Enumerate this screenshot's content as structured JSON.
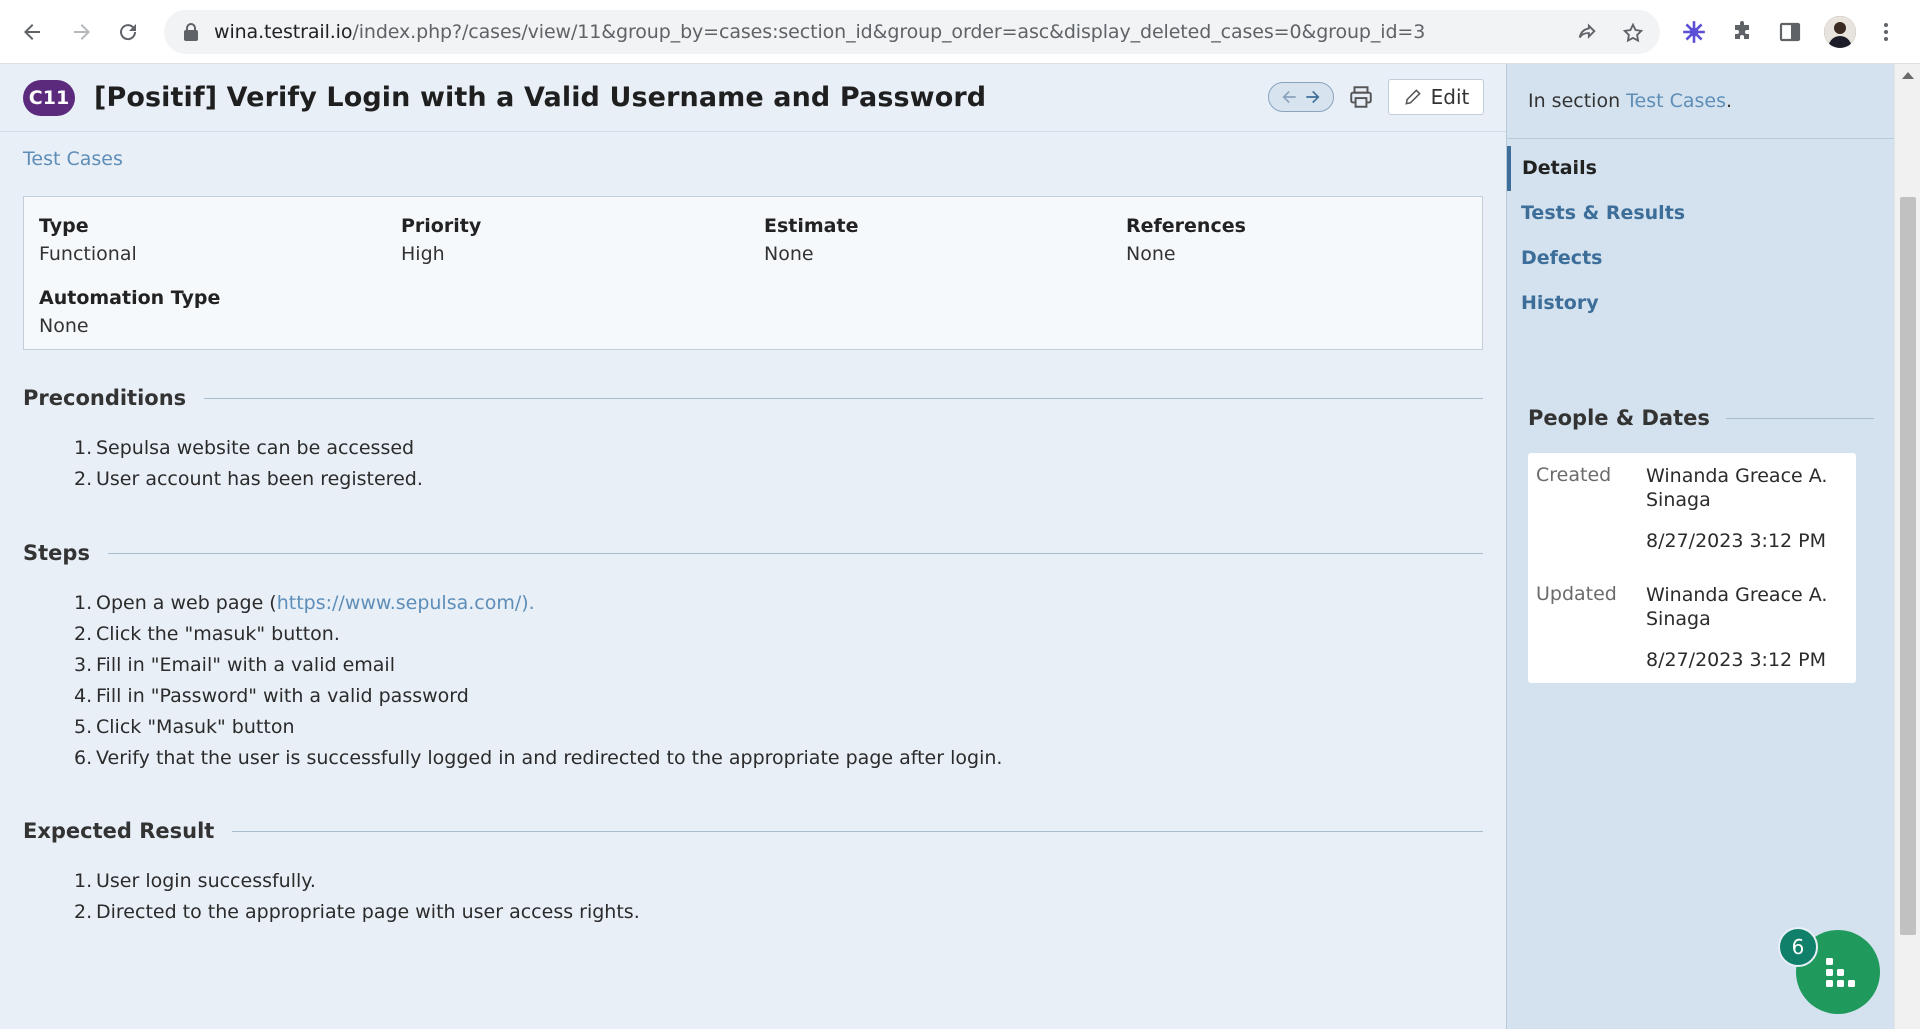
{
  "browser": {
    "url_host": "wina.testrail.io",
    "url_path": "/index.php?/cases/view/11&group_by=cases:section_id&group_order=asc&display_deleted_cases=0&group_id=3"
  },
  "case": {
    "badge": "C11",
    "title": "[Positif] Verify Login with a Valid Username and Password",
    "edit_label": "Edit",
    "breadcrumb": "Test Cases"
  },
  "fields": {
    "type": {
      "label": "Type",
      "value": "Functional"
    },
    "priority": {
      "label": "Priority",
      "value": "High"
    },
    "estimate": {
      "label": "Estimate",
      "value": "None"
    },
    "references": {
      "label": "References",
      "value": "None"
    },
    "automation_type": {
      "label": "Automation Type",
      "value": "None"
    }
  },
  "preconditions": {
    "heading": "Preconditions",
    "items": [
      {
        "num": "1.",
        "text": "Sepulsa website can be accessed"
      },
      {
        "num": "2.",
        "text": "User account has been registered."
      }
    ]
  },
  "steps": {
    "heading": "Steps",
    "items": [
      {
        "num": "1.",
        "text": "Open a web page (",
        "link": "https://www.sepulsa.com/).",
        "after": ""
      },
      {
        "num": "2.",
        "text": "Click the \"masuk\" button."
      },
      {
        "num": "3.",
        "text": "Fill in \"Email\" with a valid email"
      },
      {
        "num": "4.",
        "text": "Fill in \"Password\" with a valid password"
      },
      {
        "num": "5.",
        "text": "Click \"Masuk\" button"
      },
      {
        "num": "6.",
        "text": "Verify that the user is successfully logged in and redirected to the appropriate page after login."
      }
    ]
  },
  "expected": {
    "heading": "Expected Result",
    "items": [
      {
        "num": "1.",
        "text": "User login successfully."
      },
      {
        "num": "2.",
        "text": "Directed to the appropriate page with user access rights."
      }
    ]
  },
  "sidebar": {
    "in_section_prefix": "In section ",
    "in_section_link": "Test Cases",
    "in_section_suffix": ".",
    "nav": [
      {
        "label": "Details",
        "active": true
      },
      {
        "label": "Tests & Results",
        "active": false
      },
      {
        "label": "Defects",
        "active": false
      },
      {
        "label": "History",
        "active": false
      }
    ],
    "people_dates_heading": "People & Dates",
    "created": {
      "label": "Created",
      "who": "Winanda Greace A. Sinaga",
      "when": "8/27/2023 3:12 PM"
    },
    "updated": {
      "label": "Updated",
      "who": "Winanda Greace A. Sinaga",
      "when": "8/27/2023 3:12 PM"
    }
  },
  "widget": {
    "badge_count": "6"
  },
  "colors": {
    "accent": "#5e8eb8",
    "badge": "#5b2a7c",
    "widget": "#1f9a5c"
  }
}
